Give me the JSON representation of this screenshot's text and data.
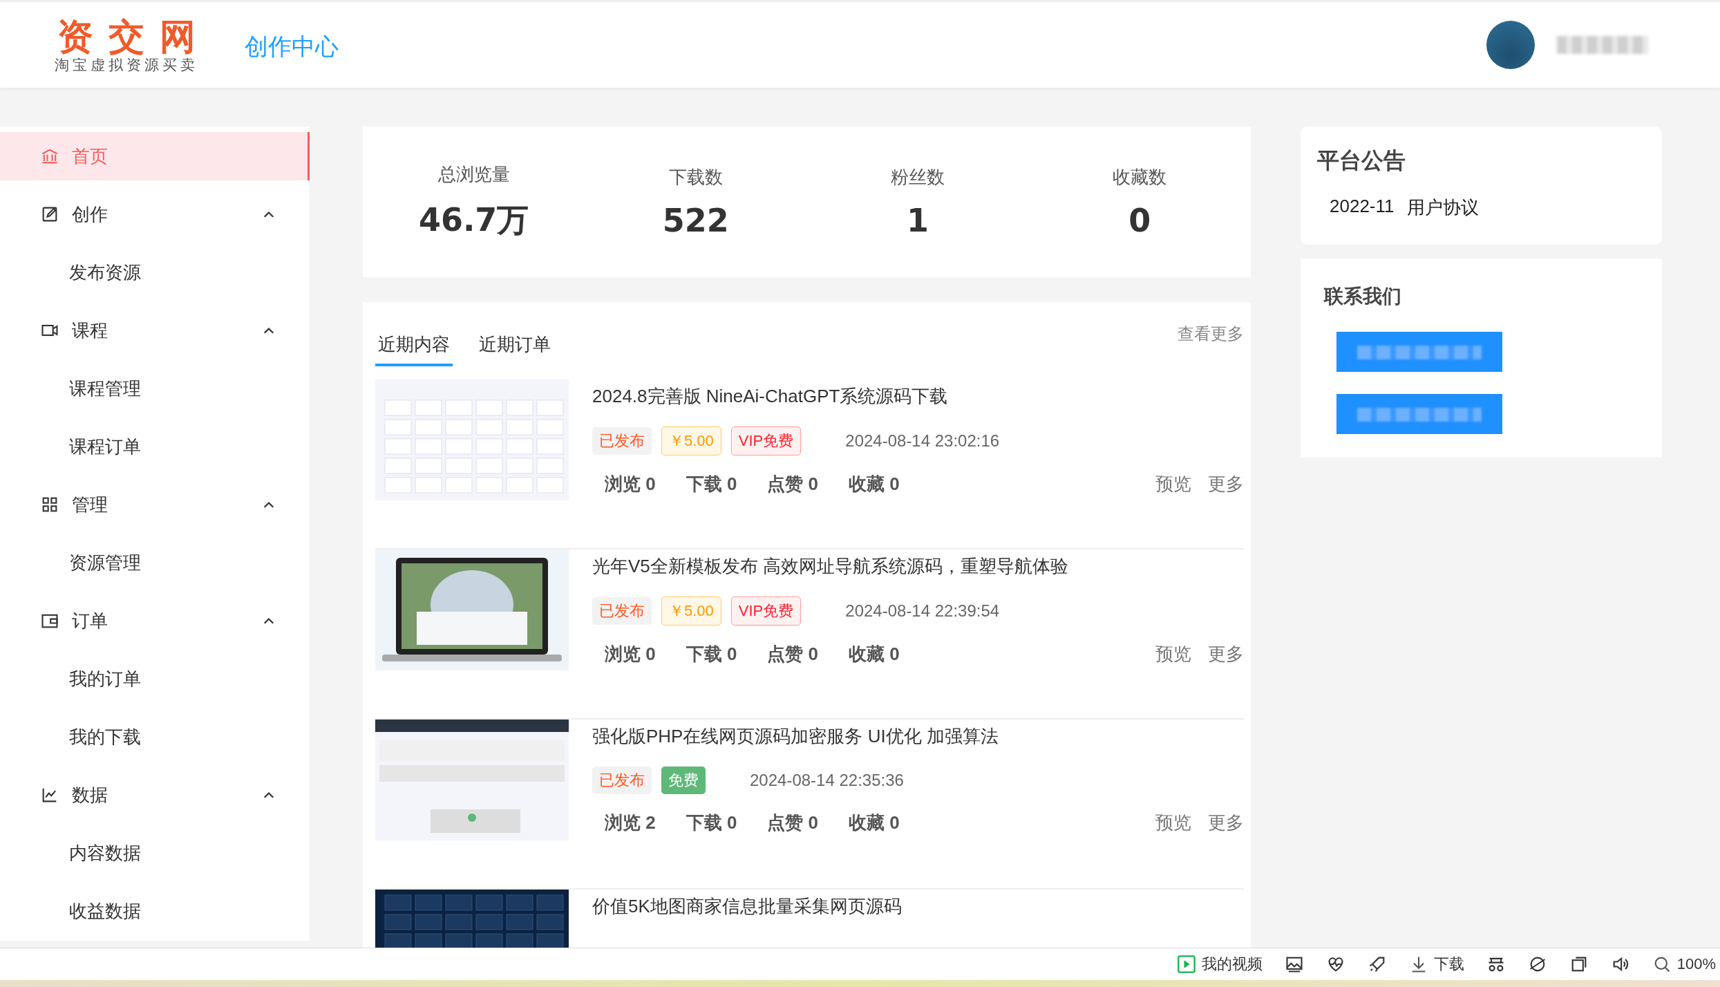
{
  "header": {
    "logo": {
      "title": "资交网",
      "subtitle": "淘宝虚拟资源买卖"
    },
    "section_title": "创作中心"
  },
  "sidebar": {
    "items": [
      {
        "label": "首页",
        "selected": true
      },
      {
        "label": "创作",
        "selected": false,
        "expanded": true,
        "children": [
          {
            "label": "发布资源",
            "selected": false
          }
        ]
      },
      {
        "label": "课程",
        "selected": false,
        "expanded": true,
        "children": [
          {
            "label": "课程管理",
            "selected": false
          },
          {
            "label": "课程订单",
            "selected": false
          }
        ]
      },
      {
        "label": "管理",
        "selected": false,
        "expanded": true,
        "children": [
          {
            "label": "资源管理",
            "selected": false
          }
        ]
      },
      {
        "label": "订单",
        "selected": false,
        "expanded": true,
        "children": [
          {
            "label": "我的订单",
            "selected": false
          },
          {
            "label": "我的下载",
            "selected": false
          }
        ]
      },
      {
        "label": "数据",
        "selected": false,
        "expanded": true,
        "children": [
          {
            "label": "内容数据",
            "selected": false
          },
          {
            "label": "收益数据",
            "selected": false
          }
        ]
      }
    ]
  },
  "stats": [
    {
      "label": "总浏览量",
      "value": "46.7万"
    },
    {
      "label": "下载数",
      "value": "522"
    },
    {
      "label": "粉丝数",
      "value": "1"
    },
    {
      "label": "收藏数",
      "value": "0"
    }
  ],
  "recent": {
    "tabs": [
      {
        "label": "近期内容",
        "selected": true
      },
      {
        "label": "近期订单",
        "selected": false
      }
    ],
    "more_link": "查看更多",
    "items": [
      {
        "title": "2024.8完善版 NineAi-ChatGPT系统源码下载",
        "tags": [
          {
            "kind": "status",
            "text": "已发布"
          },
          {
            "kind": "price",
            "text": "￥5.00"
          },
          {
            "kind": "vip",
            "text": "VIP免费"
          }
        ],
        "date": "2024-08-14 23:02:16",
        "counts": [
          "浏览 0",
          "下载 0",
          "点赞 0",
          "收藏 0"
        ],
        "actions": [
          "预览",
          "更多"
        ]
      },
      {
        "title": "光年V5全新模板发布 高效网址导航系统源码，重塑导航体验",
        "tags": [
          {
            "kind": "status",
            "text": "已发布"
          },
          {
            "kind": "price",
            "text": "￥5.00"
          },
          {
            "kind": "vip",
            "text": "VIP免费"
          }
        ],
        "date": "2024-08-14 22:39:54",
        "counts": [
          "浏览 0",
          "下载 0",
          "点赞 0",
          "收藏 0"
        ],
        "actions": [
          "预览",
          "更多"
        ]
      },
      {
        "title": "强化版PHP在线网页源码加密服务 UI优化 加强算法",
        "tags": [
          {
            "kind": "status",
            "text": "已发布"
          },
          {
            "kind": "free",
            "text": "免费"
          }
        ],
        "date": "2024-08-14 22:35:36",
        "counts": [
          "浏览 2",
          "下载 0",
          "点赞 0",
          "收藏 0"
        ],
        "actions": [
          "预览",
          "更多"
        ]
      },
      {
        "title": "价值5K地图商家信息批量采集网页源码"
      }
    ]
  },
  "notice": {
    "title": "平台公告",
    "items": [
      {
        "date": "2022-11",
        "text": "用户协议"
      }
    ]
  },
  "contact": {
    "title": "联系我们"
  },
  "browser_bar": {
    "video_label": "我的视频",
    "download_label": "下载",
    "zoom": "100%"
  }
}
